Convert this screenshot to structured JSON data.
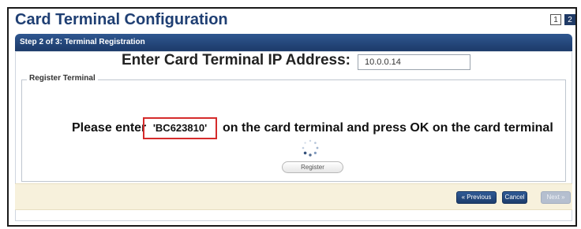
{
  "app": {
    "title": "Card Terminal Configuration",
    "pages": [
      "1",
      "2"
    ]
  },
  "step": {
    "label": "Step 2 of 3: Terminal Registration"
  },
  "register_section": {
    "legend": "Register Terminal",
    "ip_label": "Enter Card Terminal IP Address:",
    "ip_value": "10.0.0.14",
    "message_before": "Please enter",
    "code": "'BC623810'",
    "message_after": "on the card terminal and press OK on the card terminal",
    "register_label": "Register"
  },
  "actions": {
    "previous_label": "« Previous",
    "cancel_label": "Cancel",
    "next_label": "Next »"
  },
  "colors": {
    "title": "#1f3f73",
    "step_bar": "#274c82",
    "highlight_border": "#d52b2b",
    "action_bar": "#f7f1dc",
    "button": "#1d3d6c",
    "button_disabled": "#b5bfcf"
  },
  "icons": {
    "spinner": "loading-spinner-icon"
  }
}
